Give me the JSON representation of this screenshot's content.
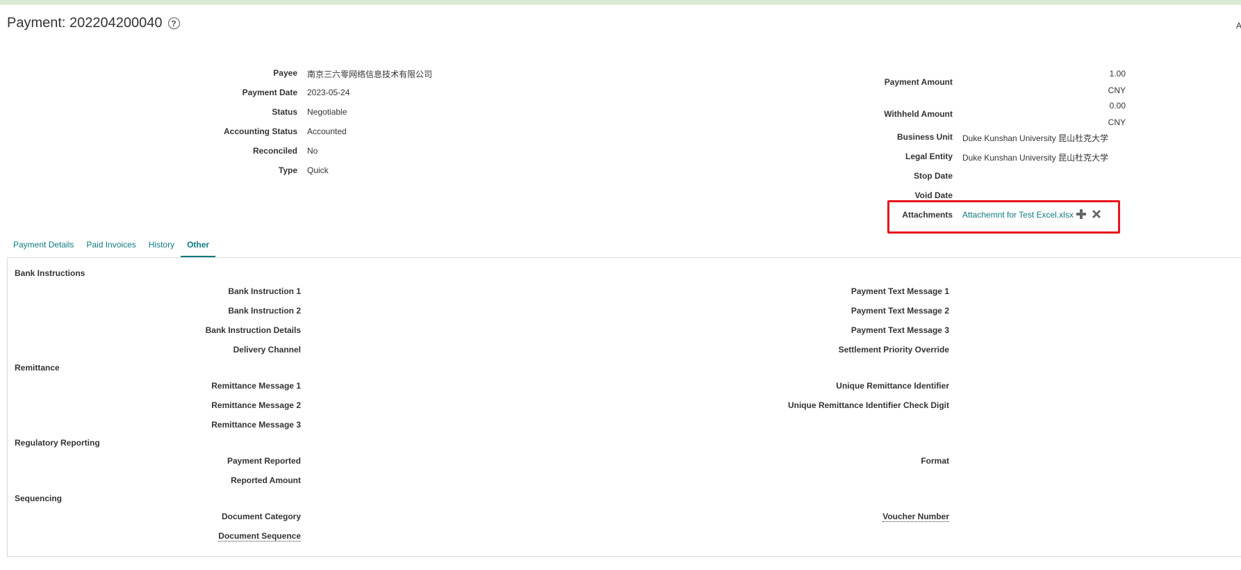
{
  "page": {
    "title": "Payment: 202204200040",
    "edge_text": "A"
  },
  "header_left": {
    "payee_label": "Payee",
    "payee_value": "南京三六零网络信息技术有限公司",
    "payment_date_label": "Payment Date",
    "payment_date_value": "2023-05-24",
    "status_label": "Status",
    "status_value": "Negotiable",
    "accounting_status_label": "Accounting Status",
    "accounting_status_value": "Accounted",
    "reconciled_label": "Reconciled",
    "reconciled_value": "No",
    "type_label": "Type",
    "type_value": "Quick"
  },
  "header_right": {
    "payment_amount_label": "Payment Amount",
    "payment_amount_value": "1.00",
    "payment_amount_currency": "CNY",
    "withheld_amount_label": "Withheld Amount",
    "withheld_amount_value": "0.00",
    "withheld_amount_currency": "CNY",
    "business_unit_label": "Business Unit",
    "business_unit_value": "Duke Kunshan University 昆山杜克大学",
    "legal_entity_label": "Legal Entity",
    "legal_entity_value": "Duke Kunshan University 昆山杜克大学",
    "stop_date_label": "Stop Date",
    "void_date_label": "Void Date",
    "attachments_label": "Attachments",
    "attachment_file": "Attachemnt for Test Excel.xlsx"
  },
  "tabs": [
    {
      "label": "Payment Details"
    },
    {
      "label": "Paid Invoices"
    },
    {
      "label": "History"
    },
    {
      "label": "Other"
    }
  ],
  "other_tab": {
    "bank_instructions": {
      "title": "Bank Instructions",
      "bank_instruction_1": "Bank Instruction 1",
      "bank_instruction_2": "Bank Instruction 2",
      "bank_instruction_details": "Bank Instruction Details",
      "delivery_channel": "Delivery Channel",
      "payment_text_message_1": "Payment Text Message 1",
      "payment_text_message_2": "Payment Text Message 2",
      "payment_text_message_3": "Payment Text Message 3",
      "settlement_priority_override": "Settlement Priority Override"
    },
    "remittance": {
      "title": "Remittance",
      "remittance_message_1": "Remittance Message 1",
      "remittance_message_2": "Remittance Message 2",
      "remittance_message_3": "Remittance Message 3",
      "unique_remittance_identifier": "Unique Remittance Identifier",
      "unique_remittance_identifier_check_digit": "Unique Remittance Identifier Check Digit"
    },
    "regulatory_reporting": {
      "title": "Regulatory Reporting",
      "payment_reported": "Payment Reported",
      "reported_amount": "Reported Amount",
      "format": "Format"
    },
    "sequencing": {
      "title": "Sequencing",
      "document_category": "Document Category",
      "document_sequence": "Document Sequence",
      "voucher_number": "Voucher Number"
    }
  },
  "colors": {
    "link": "#0e7a80",
    "highlight_box": "#e8131c",
    "top_bar": "#d9ead3"
  }
}
